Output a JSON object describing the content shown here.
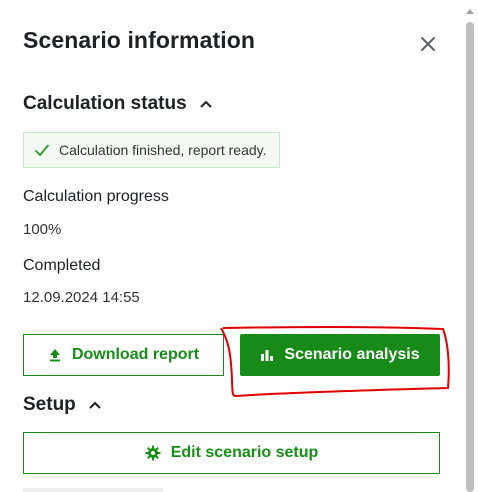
{
  "panel": {
    "title": "Scenario information",
    "close_icon": "close-icon"
  },
  "calculation_status": {
    "header": "Calculation status",
    "status_message": "Calculation finished, report ready.",
    "progress_label": "Calculation progress",
    "progress_value": "100%",
    "completed_label": "Completed",
    "completed_value": "12.09.2024 14:55",
    "download_label": "Download report",
    "analysis_label": "Scenario analysis"
  },
  "setup": {
    "header": "Setup",
    "edit_label": "Edit scenario setup"
  },
  "colors": {
    "brand_green": "#178a17",
    "highlight_red": "#e00000",
    "status_bg": "#f3faf3"
  }
}
